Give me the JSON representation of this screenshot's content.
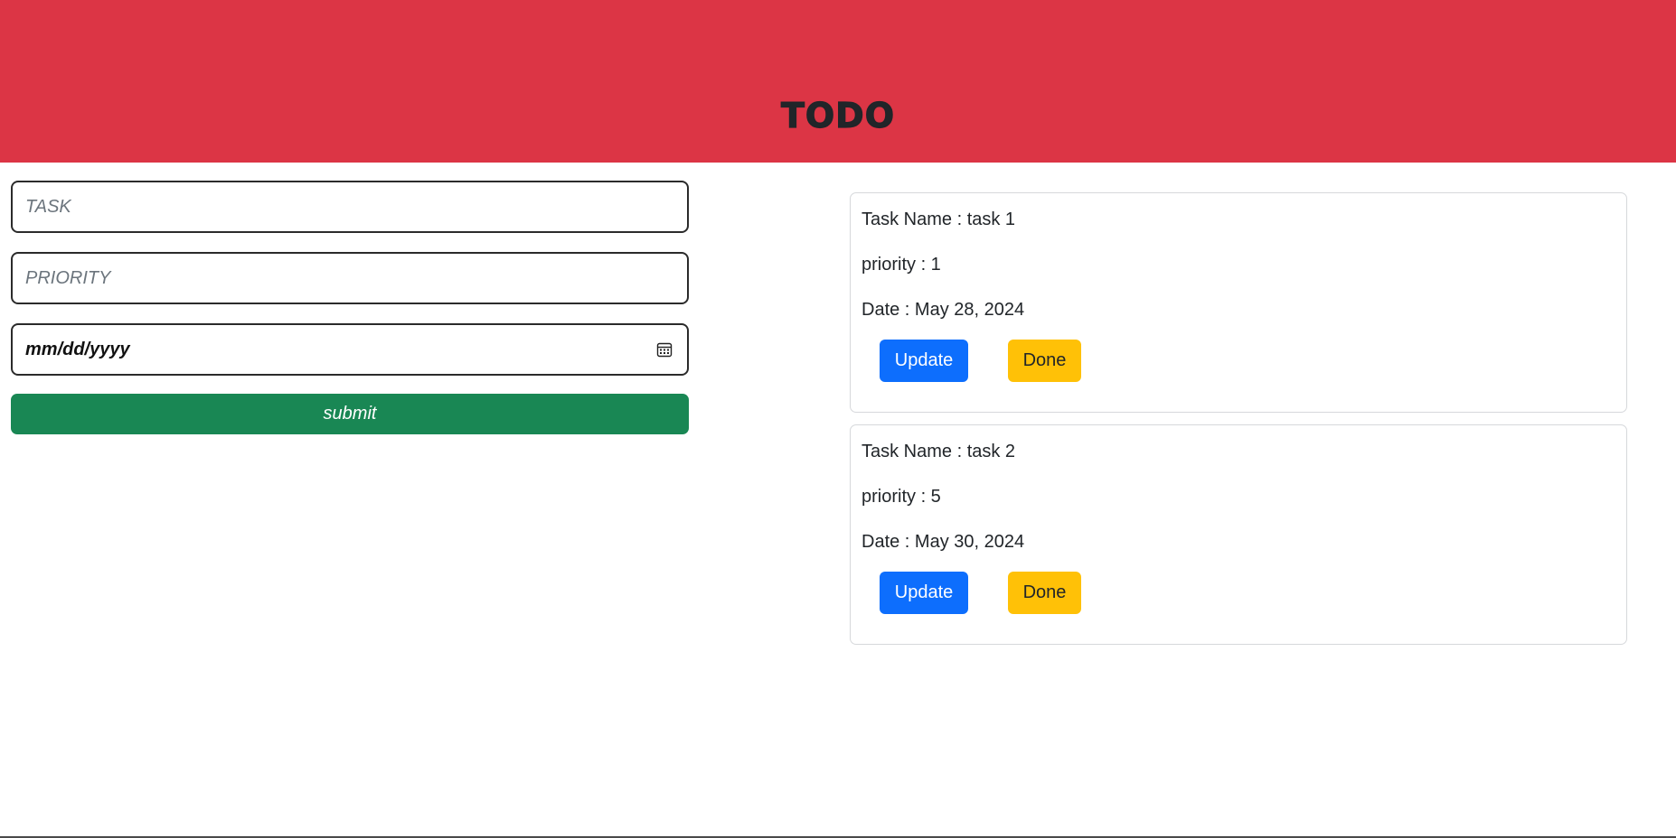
{
  "header": {
    "title": "TODO",
    "background": "#dc3545"
  },
  "form": {
    "task_placeholder": "TASK",
    "priority_placeholder": "PRIORITY",
    "date_placeholder": "mm/dd/yyyy",
    "date_icon": "calendar-icon",
    "submit_label": "submit",
    "submit_color": "#198754"
  },
  "tasks": [
    {
      "name_line": "Task Name : task 1",
      "priority_line": "priority : 1",
      "date_line": "Date : May 28, 2024",
      "update_label": "Update",
      "done_label": "Done"
    },
    {
      "name_line": "Task Name : task 2",
      "priority_line": "priority : 5",
      "date_line": "Date : May 30, 2024",
      "update_label": "Update",
      "done_label": "Done"
    }
  ],
  "colors": {
    "update_button": "#0d6efd",
    "done_button": "#ffc107"
  }
}
